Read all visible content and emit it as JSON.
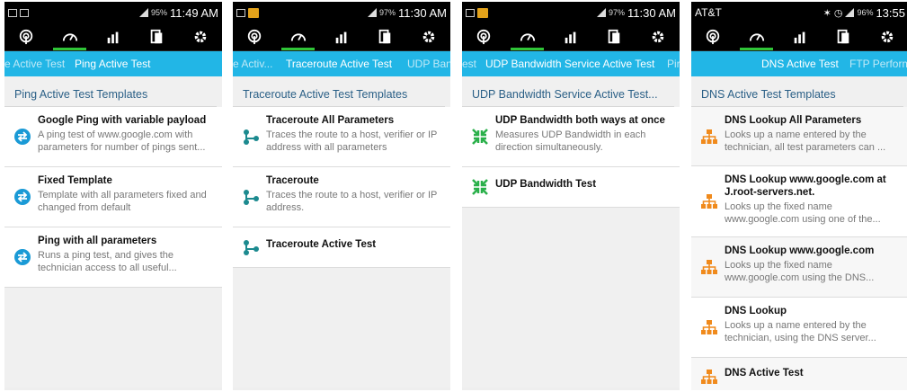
{
  "toolbar_icons": [
    "radar-icon",
    "speedometer-icon",
    "bar-chart-icon",
    "tablet-icon",
    "gear-icon"
  ],
  "colors": {
    "tab_bar": "#22b6e6",
    "active_indicator": "#2fc437",
    "section_title": "#2a5f86",
    "ping_icon": "#1a9ad6",
    "trace_icon": "#1c8a8f",
    "udp_icon": "#2ab04a",
    "dns_icon": "#f08a1c"
  },
  "screens": [
    {
      "status": {
        "battery": "95%",
        "time": "11:49 AM"
      },
      "tabs": {
        "prev": "e Active Test",
        "current": "Ping Active Test"
      },
      "section_title": "Ping Active Test Templates",
      "items": [
        {
          "title": "Google Ping with variable payload",
          "desc": "A ping test of www.google.com with parameters for number of pings sent..."
        },
        {
          "title": "Fixed Template",
          "desc": "Template with all parameters fixed and changed from default"
        },
        {
          "title": "Ping with all parameters",
          "desc": "Runs a ping test, and gives the technician access to all useful..."
        }
      ]
    },
    {
      "status": {
        "battery": "97%",
        "time": "11:30 AM"
      },
      "tabs": {
        "prev": "e Activ...",
        "current": "Traceroute Active Test",
        "next": "UDP Ban"
      },
      "section_title": "Traceroute Active Test Templates",
      "items": [
        {
          "title": "Traceroute All Parameters",
          "desc": "Traces the route to a host, verifier or IP address with all parameters"
        },
        {
          "title": "Traceroute",
          "desc": "Traces the route to a host, verifier or IP address."
        },
        {
          "title": "Traceroute Active Test",
          "desc": ""
        }
      ]
    },
    {
      "status": {
        "battery": "97%",
        "time": "11:30 AM"
      },
      "tabs": {
        "prev": "est",
        "current": "UDP Bandwidth Service Active Test",
        "next": "Pir"
      },
      "section_title": "UDP Bandwidth Service Active Test...",
      "items": [
        {
          "title": "UDP Bandwidth both ways at once",
          "desc": "Measures UDP Bandwidth in each direction simultaneously."
        },
        {
          "title": "UDP Bandwidth Test",
          "desc": ""
        }
      ]
    },
    {
      "status": {
        "carrier": "AT&T",
        "battery": "96%",
        "time": "13:55"
      },
      "tabs": {
        "current": "DNS Active Test",
        "next": "FTP Perform"
      },
      "section_title": "DNS Active Test Templates",
      "items": [
        {
          "title": "DNS Lookup All Parameters",
          "desc": "Looks up a name entered by the technician, all test parameters can ..."
        },
        {
          "title": "DNS Lookup www.google.com at J.root-servers.net.",
          "desc": "Looks up the fixed name www.google.com using one of the..."
        },
        {
          "title": "DNS Lookup www.google.com",
          "desc": "Looks up the fixed name www.google.com using the DNS..."
        },
        {
          "title": "DNS Lookup",
          "desc": "Looks up a name entered by the technician, using the DNS server..."
        },
        {
          "title": "DNS Active Test",
          "desc": ""
        }
      ]
    }
  ]
}
